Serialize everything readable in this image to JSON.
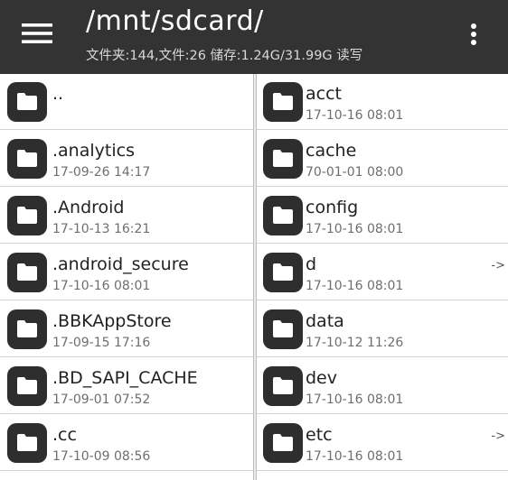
{
  "header": {
    "path": "/mnt/sdcard/",
    "stats": "文件夹:144,文件:26 储存:1.24G/31.99G 读写",
    "menu_icon": "hamburger-menu-icon",
    "overflow_icon": "more-vertical-icon"
  },
  "colors": {
    "toolbar": "#333333",
    "folder_icon_bg": "#2e2e2e",
    "list_bg": "#ffffff",
    "divider": "#bdbdbd"
  },
  "files_left": [
    {
      "name": "..",
      "date": ""
    },
    {
      "name": ".analytics",
      "date": "17-09-26 14:17"
    },
    {
      "name": ".Android",
      "date": "17-10-13 16:21"
    },
    {
      "name": ".android_secure",
      "date": "17-10-16 08:01"
    },
    {
      "name": ".BBKAppStore",
      "date": "17-09-15 17:16"
    },
    {
      "name": ".BD_SAPI_CACHE",
      "date": "17-09-01 07:52"
    },
    {
      "name": ".cc",
      "date": "17-10-09 08:56"
    }
  ],
  "files_right": [
    {
      "name": "acct",
      "date": "17-10-16 08:01",
      "link": ""
    },
    {
      "name": "cache",
      "date": "70-01-01 08:00",
      "link": ""
    },
    {
      "name": "config",
      "date": "17-10-16 08:01",
      "link": ""
    },
    {
      "name": "d",
      "date": "17-10-16 08:01",
      "link": "->"
    },
    {
      "name": "data",
      "date": "17-10-12 11:26",
      "link": ""
    },
    {
      "name": "dev",
      "date": "17-10-16 08:01",
      "link": ""
    },
    {
      "name": "etc",
      "date": "17-10-16 08:01",
      "link": "->"
    }
  ]
}
